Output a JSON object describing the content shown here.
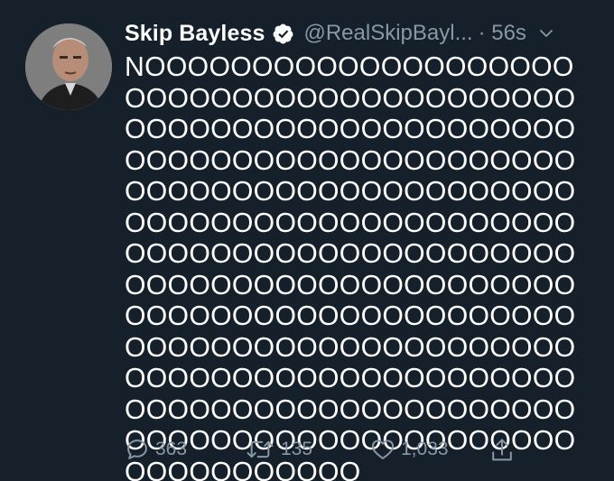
{
  "tweet": {
    "author_name": "Skip Bayless",
    "author_handle": "@RealSkipBayl...",
    "time": "· 56s",
    "text": "NOOOOOOOOOOOOOOOOOOOOOOOOOOOOOOOOOOOOOOOOOOOOOOOOOOOOOOOOOOOOOOOOOOOOOOOOOOOOOOOOOOOOOOOOOOOOOOOOOOOOOOOOOOOOOOOOOOOOOOOOOOOOOOOOOOOOOOOOOOOOOOOOOOOOOOOOOOOOOOOOOOOOOOOOOOOOOOOOOOOOOOOOOOOOOOOOOOOOOOOOOOOOOOOOOOOOOOOOOOOOOOOOOOOOOOOOOOOOOOOOOOOOOOOOOOOOOOOOOOOOOOOOOOOOOOOOOOOOOOOOOOO",
    "reply_count": "363",
    "retweet_count": "135",
    "like_count": "1,033"
  },
  "icons": {
    "verified": "verified-badge-icon",
    "menu": "chevron-down-icon",
    "reply": "reply-icon",
    "retweet": "retweet-icon",
    "like": "heart-icon",
    "share": "share-icon"
  },
  "colors": {
    "background": "#15202b",
    "text": "#ffffff",
    "secondary": "#8899a6"
  }
}
